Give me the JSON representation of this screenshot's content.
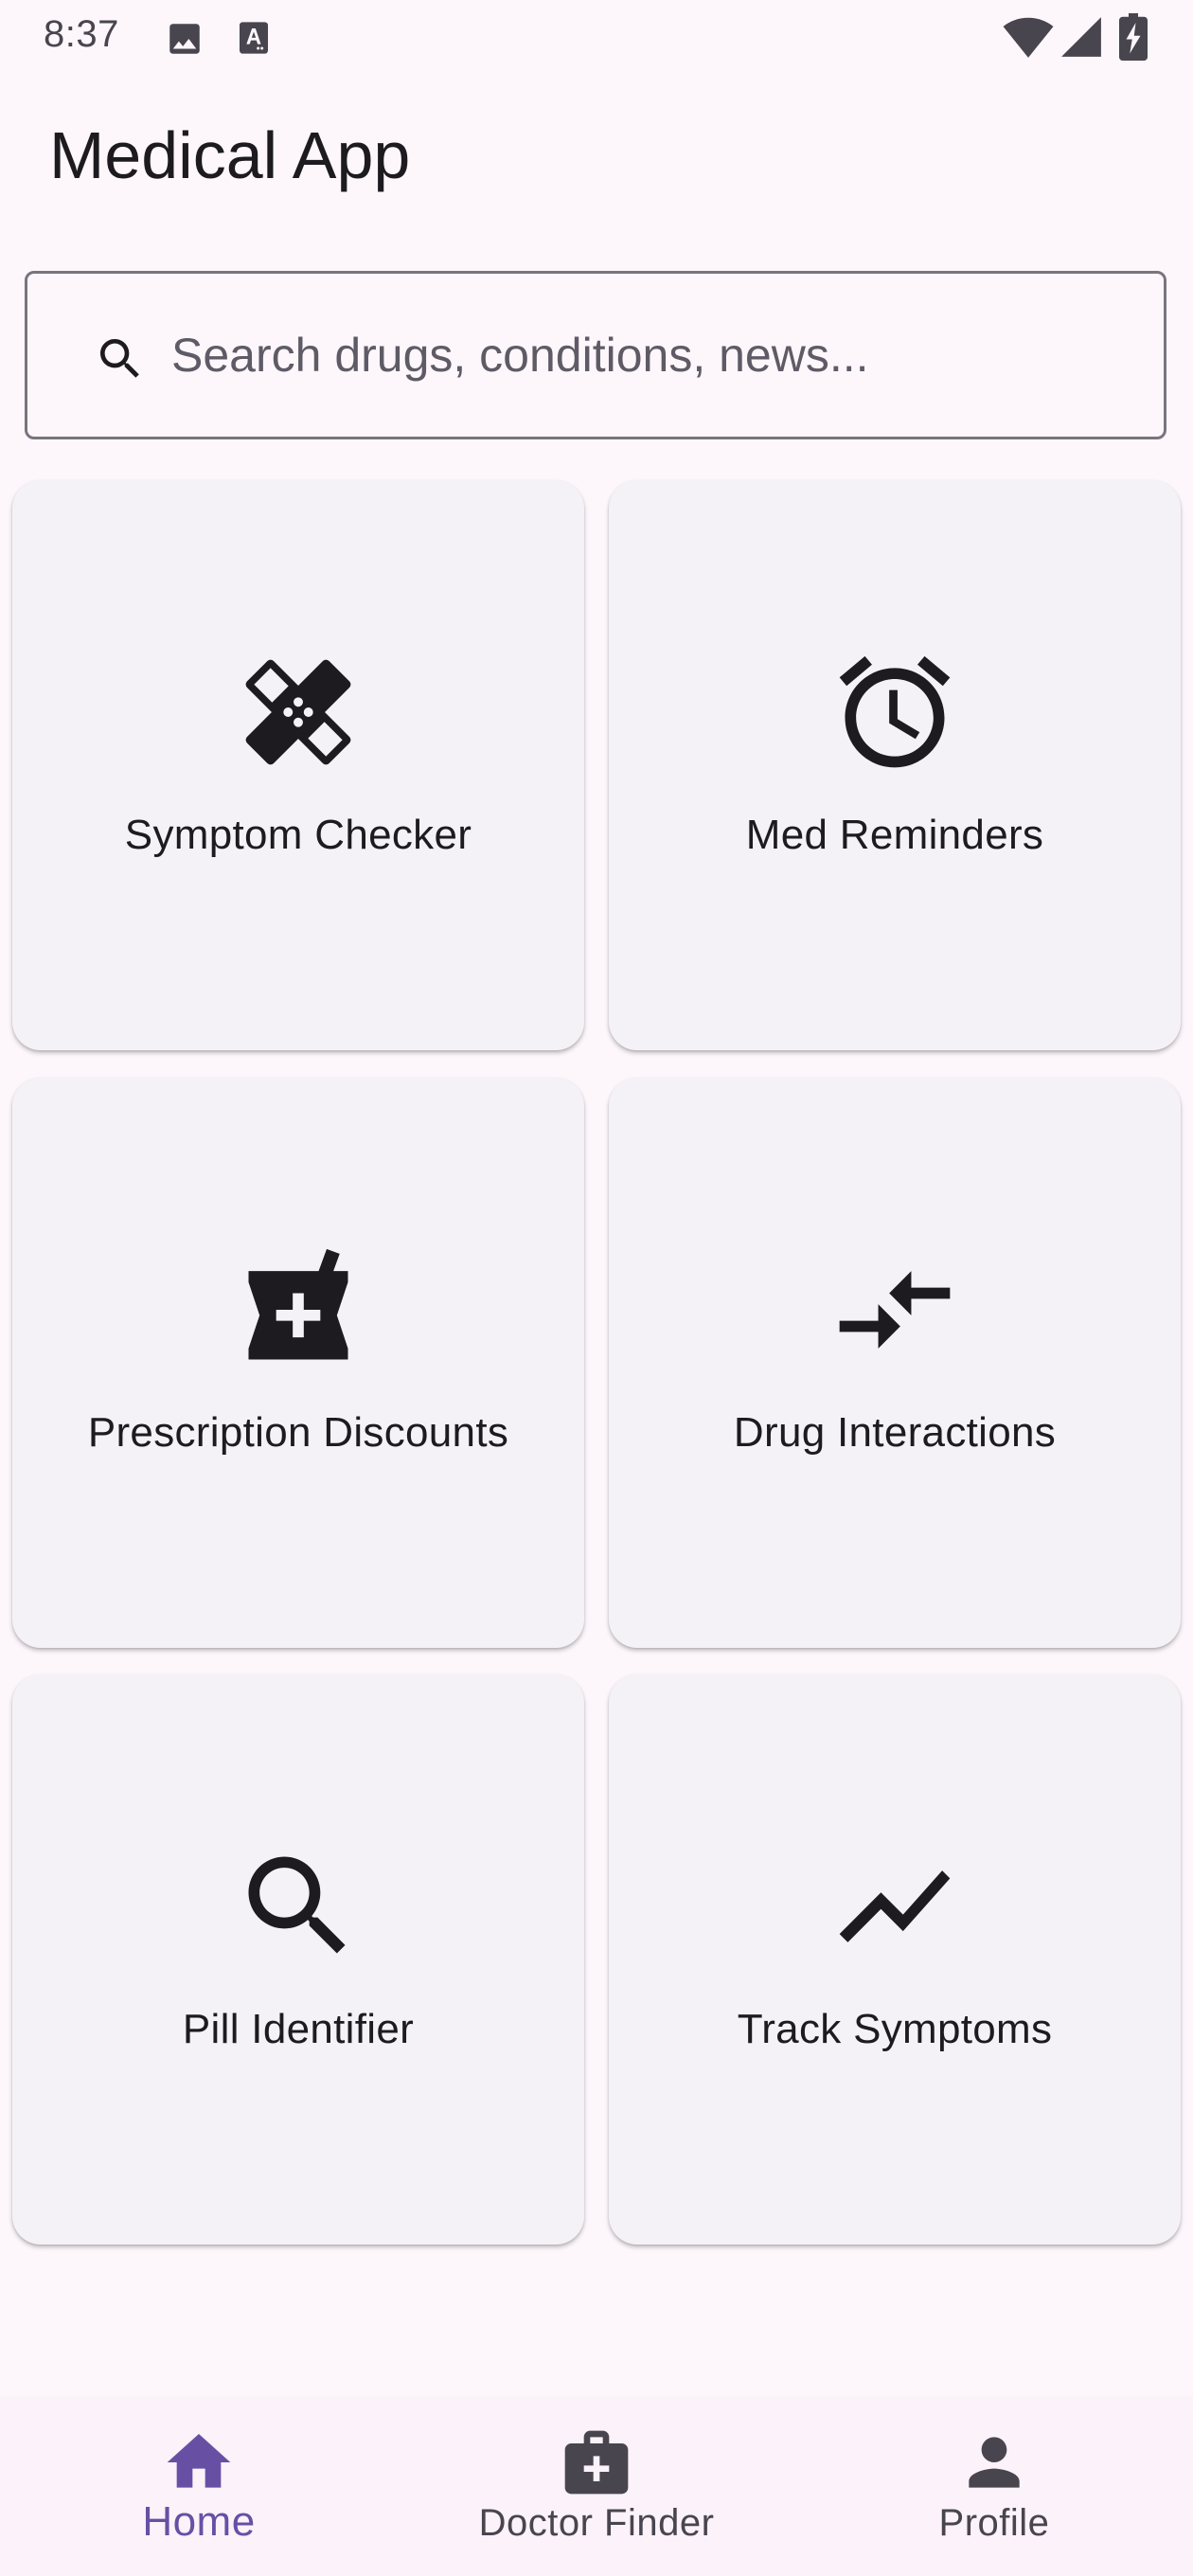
{
  "status_bar": {
    "time": "8:37",
    "icons": [
      "image-icon",
      "font-icon",
      "wifi-icon",
      "signal-icon",
      "battery-charging-icon"
    ]
  },
  "app": {
    "title": "Medical App"
  },
  "search": {
    "placeholder": "Search drugs, conditions, news...",
    "value": ""
  },
  "cards": [
    {
      "label": "Symptom Checker",
      "icon": "bandage-icon"
    },
    {
      "label": "Med Reminders",
      "icon": "alarm-clock-icon"
    },
    {
      "label": "Prescription Discounts",
      "icon": "pharmacy-icon"
    },
    {
      "label": "Drug Interactions",
      "icon": "compare-arrows-icon"
    },
    {
      "label": "Pill Identifier",
      "icon": "search-icon"
    },
    {
      "label": "Track Symptoms",
      "icon": "trending-line-icon"
    }
  ],
  "bottom_nav": {
    "items": [
      {
        "label": "Home",
        "icon": "home-icon",
        "active": true
      },
      {
        "label": "Doctor Finder",
        "icon": "medical-bag-icon",
        "active": false
      },
      {
        "label": "Profile",
        "icon": "person-icon",
        "active": false
      }
    ]
  },
  "colors": {
    "background": "#fdf7fc",
    "card": "#f5f2f7",
    "accent": "#6750a4",
    "text": "#1d1b20",
    "muted": "#49454f"
  }
}
